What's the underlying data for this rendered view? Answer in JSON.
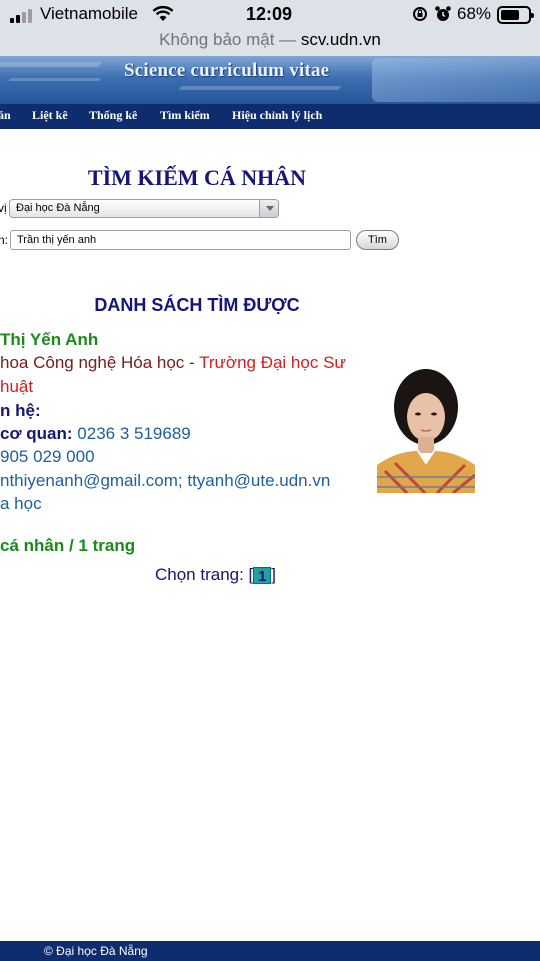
{
  "status_bar": {
    "carrier": "Vietnamobile",
    "time": "12:09",
    "battery_percent": "68%",
    "battery_level": 0.68
  },
  "address_bar": {
    "insecure_label": "Không bảo mật —",
    "domain": "scv.udn.vn"
  },
  "banner": {
    "title": "Science curriculum vitae"
  },
  "nav": {
    "items": [
      "ăn",
      "Liệt kê",
      "Thống kê",
      "Tìm kiếm",
      "Hiệu chỉnh lý lịch"
    ]
  },
  "search": {
    "heading": "TÌM KIẾM CÁ NHÂN",
    "unit_label_fragment": "vị",
    "unit_selected": "Đại học Đà Nẵng",
    "name_label_fragment": "n:",
    "name_value": "Trần thị yến anh",
    "submit_label": "Tìm"
  },
  "results": {
    "heading": "DANH SÁCH TÌM ĐƯỢC",
    "entry": {
      "name": "Thị Yến Anh",
      "department": "hoa Công nghệ Hóa học",
      "separator": " - ",
      "school_line1": "Trường Đại học Sư",
      "school_line2": "huật",
      "contact_heading": "n hệ:",
      "office_phone_label": "cơ quan:",
      "office_phone": "0236 3 519689",
      "mobile": "905 029 000",
      "emails": "nthiyenanh@gmail.com; ttyanh@ute.udn.vn",
      "link": "a học"
    },
    "summary": "cá nhân / 1 trang",
    "paging_label": "Chọn trang: [",
    "paging_close": "]",
    "current_page": "1"
  },
  "footer": {
    "copyright": "© Đại học Đà Nẵng"
  },
  "colors": {
    "nav_bg": "#0d2d6e",
    "heading": "#15157a",
    "name_green": "#1b8a1b",
    "school_red": "#d81c1c",
    "contact_blue": "#1d5fa0"
  }
}
